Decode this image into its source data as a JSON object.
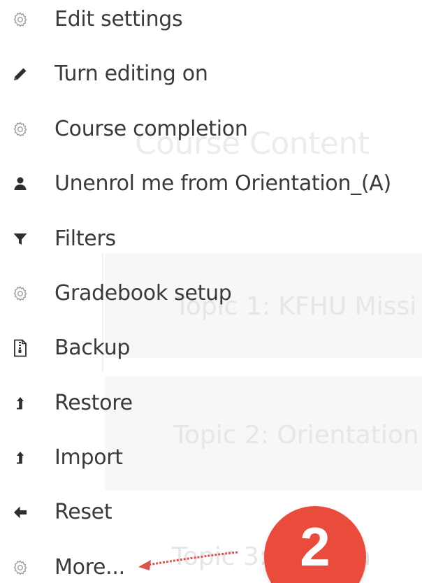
{
  "background": {
    "title": "Course Content",
    "topics": [
      "Topic 1: KFHU Missi",
      "Topic 2: Orientation",
      "Topic 3: ...al Sta"
    ]
  },
  "menu": {
    "items": [
      {
        "icon": "gear-icon",
        "label": "Edit settings"
      },
      {
        "icon": "pencil-icon",
        "label": "Turn editing on"
      },
      {
        "icon": "gear-icon",
        "label": "Course completion"
      },
      {
        "icon": "user-icon",
        "label": "Unenrol me from Orientation_(A)"
      },
      {
        "icon": "filter-icon",
        "label": "Filters"
      },
      {
        "icon": "gear-icon",
        "label": "Gradebook setup"
      },
      {
        "icon": "file-archive-icon",
        "label": "Backup"
      },
      {
        "icon": "upload-icon",
        "label": "Restore"
      },
      {
        "icon": "upload-icon",
        "label": "Import"
      },
      {
        "icon": "arrow-left-icon",
        "label": "Reset"
      },
      {
        "icon": "gear-icon",
        "label": "More..."
      }
    ]
  },
  "annotation": {
    "step_number": "2",
    "color": "#e94c3d",
    "arrow_color": "#d9534f"
  }
}
